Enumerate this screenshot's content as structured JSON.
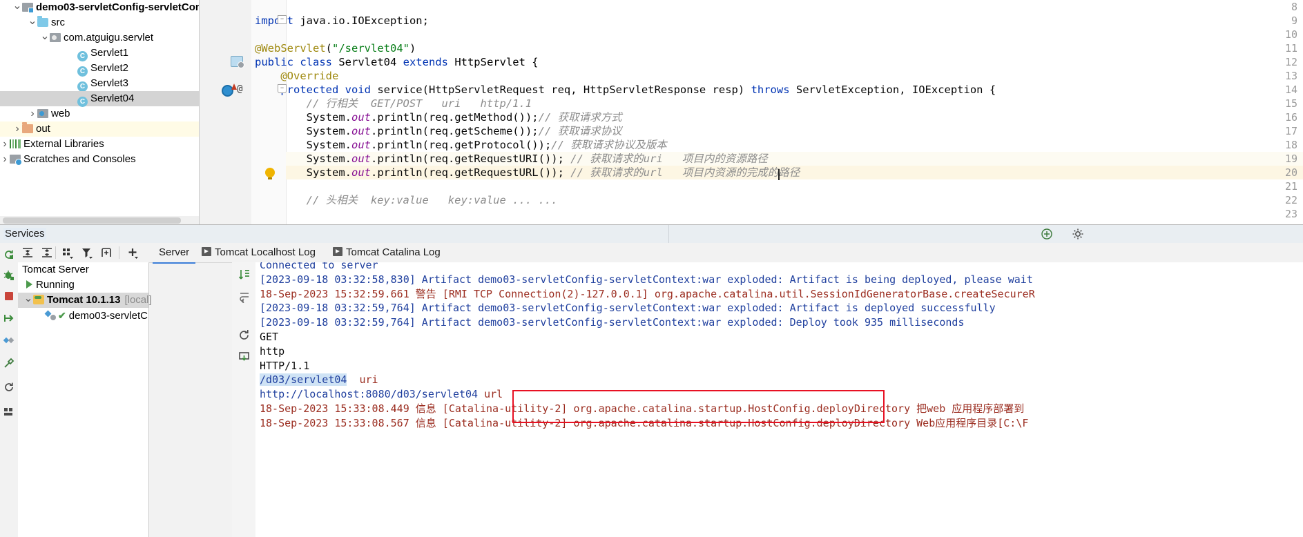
{
  "project_tree": {
    "items": [
      {
        "arrow": "v",
        "indent": 18,
        "icon": "module-icon",
        "label": "demo03-servletConfig-servletCon",
        "bold": true,
        "selected": false,
        "highlight": false
      },
      {
        "arrow": "v",
        "indent": 40,
        "icon": "folder-icon",
        "label": "src",
        "bold": false,
        "selected": false,
        "highlight": false
      },
      {
        "arrow": "v",
        "indent": 58,
        "icon": "package-icon",
        "label": "com.atguigu.servlet",
        "bold": false,
        "selected": false,
        "highlight": false
      },
      {
        "arrow": "",
        "indent": 98,
        "icon": "java-class-icon",
        "label": "Servlet1",
        "bold": false,
        "selected": false,
        "highlight": false
      },
      {
        "arrow": "",
        "indent": 98,
        "icon": "java-class-icon",
        "label": "Servlet2",
        "bold": false,
        "selected": false,
        "highlight": false
      },
      {
        "arrow": "",
        "indent": 98,
        "icon": "java-class-icon",
        "label": "Servlet3",
        "bold": false,
        "selected": false,
        "highlight": false
      },
      {
        "arrow": "",
        "indent": 98,
        "icon": "java-class-icon",
        "label": "Servlet04",
        "bold": false,
        "selected": true,
        "highlight": false
      },
      {
        "arrow": ">",
        "indent": 40,
        "icon": "web-folder-icon",
        "label": "web",
        "bold": false,
        "selected": false,
        "highlight": false
      },
      {
        "arrow": ">",
        "indent": 18,
        "icon": "folder-orange-icon",
        "label": "out",
        "bold": false,
        "selected": false,
        "highlight": true
      },
      {
        "arrow": ">",
        "indent": 0,
        "icon": "external-libraries-icon",
        "label": "External Libraries",
        "bold": false,
        "selected": false,
        "highlight": false
      },
      {
        "arrow": ">",
        "indent": 0,
        "icon": "scratches-icon",
        "label": "Scratches and Consoles",
        "bold": false,
        "selected": false,
        "highlight": false
      }
    ]
  },
  "editor": {
    "line_numbers": [
      "8",
      "9",
      "10",
      "11",
      "12",
      "13",
      "14",
      "15",
      "16",
      "17",
      "18",
      "19",
      "20",
      "21",
      "22",
      "23"
    ],
    "lines": [
      {
        "num": "8",
        "segments": []
      },
      {
        "num": "9",
        "segments": [
          {
            "t": "import ",
            "c": "kw"
          },
          {
            "t": "java.io.IOException;",
            "c": "plain"
          }
        ]
      },
      {
        "num": "10",
        "segments": []
      },
      {
        "num": "11",
        "segments": [
          {
            "t": "@WebServlet",
            "c": "ann"
          },
          {
            "t": "(",
            "c": "plain"
          },
          {
            "t": "\"/servlet04\"",
            "c": "str"
          },
          {
            "t": ")",
            "c": "plain"
          }
        ]
      },
      {
        "num": "12",
        "segments": [
          {
            "t": "public class ",
            "c": "kw"
          },
          {
            "t": "Servlet04 ",
            "c": "cls"
          },
          {
            "t": "extends ",
            "c": "kw"
          },
          {
            "t": "HttpServlet {",
            "c": "cls"
          }
        ]
      },
      {
        "num": "13",
        "segments": [
          {
            "t": "    ",
            "c": "plain"
          },
          {
            "t": "@Override",
            "c": "ann"
          }
        ]
      },
      {
        "num": "14",
        "segments": [
          {
            "t": "    ",
            "c": "plain"
          },
          {
            "t": "protected void ",
            "c": "kw"
          },
          {
            "t": "service(HttpServletRequest req, HttpServletResponse resp) ",
            "c": "plain"
          },
          {
            "t": "throws ",
            "c": "kw"
          },
          {
            "t": "ServletException, IOException {",
            "c": "plain"
          }
        ]
      },
      {
        "num": "15",
        "segments": [
          {
            "t": "        ",
            "c": "plain"
          },
          {
            "t": "// 行相关  GET/POST   uri   http/1.1",
            "c": "cmt"
          }
        ]
      },
      {
        "num": "16",
        "segments": [
          {
            "t": "        System.",
            "c": "plain"
          },
          {
            "t": "out",
            "c": "fld"
          },
          {
            "t": ".println(req.getMethod());",
            "c": "plain"
          },
          {
            "t": "// 获取请求方式",
            "c": "cmt"
          }
        ]
      },
      {
        "num": "17",
        "segments": [
          {
            "t": "        System.",
            "c": "plain"
          },
          {
            "t": "out",
            "c": "fld"
          },
          {
            "t": ".println(req.getScheme());",
            "c": "plain"
          },
          {
            "t": "// 获取请求协议",
            "c": "cmt"
          }
        ]
      },
      {
        "num": "18",
        "segments": [
          {
            "t": "        System.",
            "c": "plain"
          },
          {
            "t": "out",
            "c": "fld"
          },
          {
            "t": ".println(req.getProtocol());",
            "c": "plain"
          },
          {
            "t": "// 获取请求协议及版本",
            "c": "cmt"
          }
        ]
      },
      {
        "num": "19",
        "segments": [
          {
            "t": "        System.",
            "c": "plain"
          },
          {
            "t": "out",
            "c": "fld"
          },
          {
            "t": ".println(req.getRequestURI()); ",
            "c": "plain"
          },
          {
            "t": "// 获取请求的uri   项目内的资源路径",
            "c": "cmt"
          }
        ]
      },
      {
        "num": "20",
        "segments": [
          {
            "t": "        System.",
            "c": "plain"
          },
          {
            "t": "out",
            "c": "fld"
          },
          {
            "t": ".println(req.getRequestURL()); ",
            "c": "plain"
          },
          {
            "t": "// 获取请求的url   项目内资源的完成的路径",
            "c": "cmt"
          }
        ]
      },
      {
        "num": "21",
        "segments": []
      },
      {
        "num": "22",
        "segments": [
          {
            "t": "        ",
            "c": "plain"
          },
          {
            "t": "// 头相关  key:value   key:value ... ...",
            "c": "cmt"
          }
        ]
      },
      {
        "num": "23",
        "segments": []
      }
    ]
  },
  "services": {
    "title": "Services",
    "toolbar_icons": [
      "rerun-icon",
      "expand-all-icon",
      "collapse-all-icon",
      "group-by-icon",
      "filter-icon",
      "add-tab-icon",
      "add-service-icon"
    ],
    "strip_icons": [
      "rerun-icon",
      "debug-icon",
      "stop-icon",
      "redeploy-icon",
      "deploy-icon",
      "settings-icon",
      "restart-icon",
      "dashboard-icon"
    ],
    "header_icons": [
      "hide-icon",
      "settings-gear-icon"
    ],
    "tree": [
      {
        "indent": 6,
        "arrow": "",
        "icon": "tomcat-server-icon",
        "label": "Tomcat Server",
        "bold": false,
        "dim": "",
        "selected": false
      },
      {
        "indent": 12,
        "arrow": "",
        "icon": "running-icon",
        "label": "Running",
        "bold": false,
        "dim": "",
        "selected": false
      },
      {
        "indent": 8,
        "arrow": "v",
        "icon": "tomcat-icon",
        "label": "Tomcat 10.1.13",
        "bold": true,
        "dim": "[local]",
        "selected": true
      },
      {
        "indent": 40,
        "arrow": "",
        "icon": "artifact-icon",
        "label": "demo03-servletC",
        "bold": false,
        "dim": "",
        "selected": false
      }
    ]
  },
  "console_tabs": [
    {
      "label": "Server",
      "icon": "",
      "active": true
    },
    {
      "label": "Tomcat Localhost Log",
      "icon": "run-icon",
      "active": false
    },
    {
      "label": "Tomcat Catalina Log",
      "icon": "run-icon",
      "active": false
    }
  ],
  "console_strip_icons": [
    "scroll-to-end-icon",
    "soft-wrap-icon",
    "restart-icon",
    "print-icon"
  ],
  "console_output": [
    {
      "segments": [
        {
          "t": "Connected to server",
          "c": "o-blue"
        }
      ],
      "clipped": true
    },
    {
      "segments": [
        {
          "t": "[2023-09-18 03:32:58,830] Artifact demo03-servletConfig-servletContext:war exploded: Artifact is being deployed, please wait",
          "c": "o-blue"
        }
      ]
    },
    {
      "segments": [
        {
          "t": "18-Sep-2023 15:32:59.661 警告 [RMI TCP Connection(2)-127.0.0.1] org.apache.catalina.util.SessionIdGeneratorBase.createSecureR",
          "c": "o-red"
        }
      ]
    },
    {
      "segments": [
        {
          "t": "[2023-09-18 03:32:59,764] Artifact demo03-servletConfig-servletContext:war exploded: Artifact is deployed successfully",
          "c": "o-blue"
        }
      ]
    },
    {
      "segments": [
        {
          "t": "[2023-09-18 03:32:59,764] Artifact demo03-servletConfig-servletContext:war exploded: Deploy took 935 milliseconds",
          "c": "o-blue"
        }
      ]
    },
    {
      "segments": [
        {
          "t": "GET",
          "c": "o-dark"
        }
      ]
    },
    {
      "segments": [
        {
          "t": "http",
          "c": "o-dark"
        }
      ]
    },
    {
      "segments": [
        {
          "t": "HTTP/1.1",
          "c": "o-dark"
        }
      ]
    },
    {
      "segments": [
        {
          "t": "/d03/servlet04",
          "c": "o-sel o-blue"
        },
        {
          "t": "  ",
          "c": "o-dark"
        },
        {
          "t": "uri",
          "c": "o-red"
        }
      ]
    },
    {
      "segments": [
        {
          "t": "http://localhost:8080/d03/servlet04",
          "c": "o-blue"
        },
        {
          "t": " ",
          "c": "o-dark"
        },
        {
          "t": "url",
          "c": "o-red"
        }
      ]
    },
    {
      "segments": [
        {
          "t": "18-Sep-2023 15:33:08.449 信息 [Catalina-utility-2] org.apache.catalina.startup.HostConfig.deployDirectory 把web 应用程序部署到",
          "c": "o-red"
        }
      ]
    },
    {
      "segments": [
        {
          "t": "18-Sep-2023 15:33:08.567 信息 [Catalina-utility-2] org.apache.catalina.startup.HostConfig.deployDirectory Web应用程序目录[C:\\F",
          "c": "o-red"
        }
      ]
    }
  ],
  "colors": {
    "accent_blue": "#3b7dd8",
    "red_box": "#e81123",
    "selection_gray": "#d4d4d4",
    "console_blue": "#1f3f9e",
    "console_red": "#9b2d20"
  }
}
